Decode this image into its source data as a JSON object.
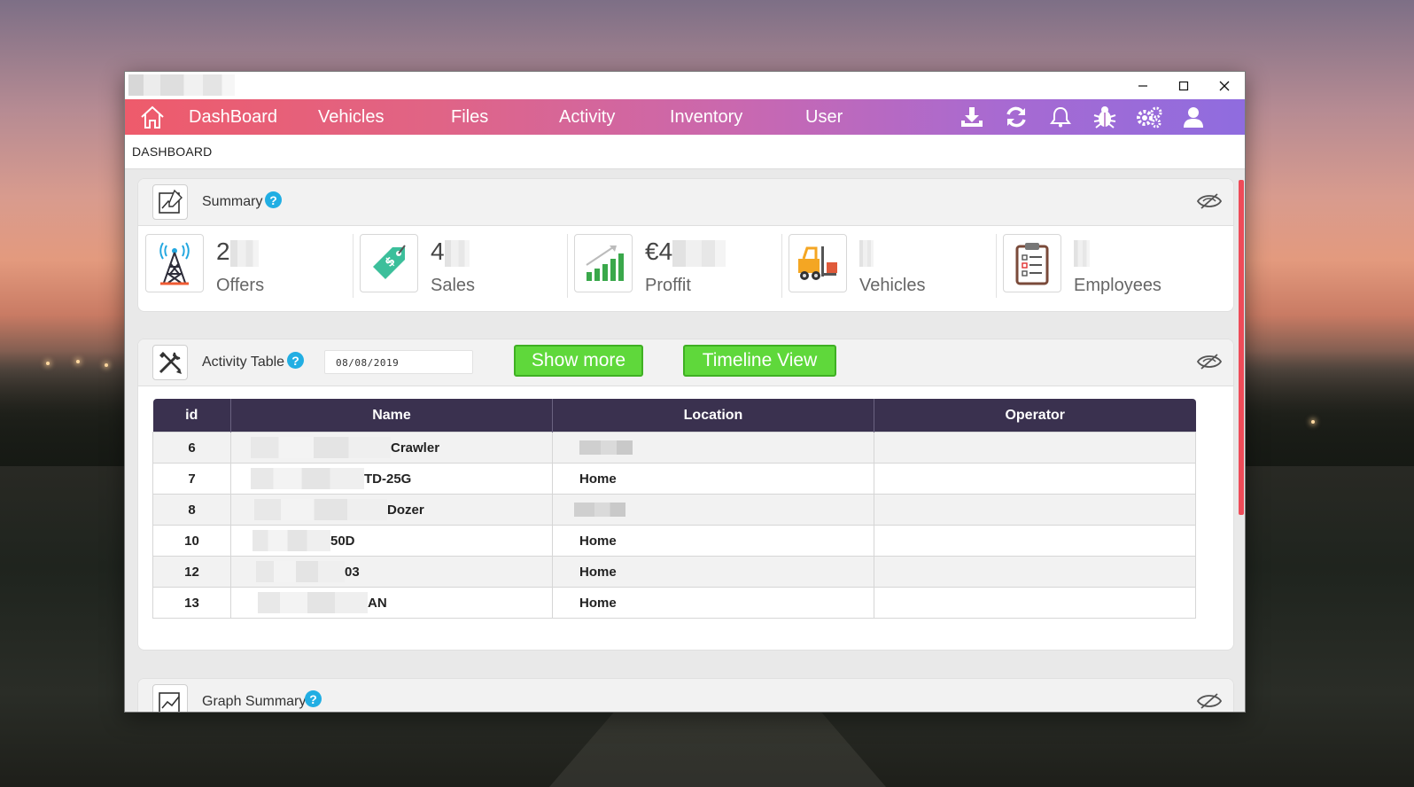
{
  "nav": {
    "items": [
      "DashBoard",
      "Vehicles",
      "Files",
      "Activity",
      "Inventory",
      "User"
    ],
    "icons": [
      "home-icon",
      "download-icon",
      "refresh-icon",
      "bell-icon",
      "bug-icon",
      "settings-icon",
      "user-icon"
    ]
  },
  "window": {
    "controls": {
      "minimize": "–",
      "maximize": "☐",
      "close": "✕"
    }
  },
  "breadcrumb": "DASHBOARD",
  "summary": {
    "title": "Summary",
    "help": "?",
    "stats": [
      {
        "value": "2",
        "label": "Offers",
        "icon": "radio-tower-icon"
      },
      {
        "value": "4",
        "label": "Sales",
        "icon": "price-tag-icon"
      },
      {
        "value": "€4",
        "label": "Proffit",
        "icon": "growth-chart-icon"
      },
      {
        "value": "",
        "label": "Vehicles",
        "icon": "forklift-icon"
      },
      {
        "value": "",
        "label": "Employees",
        "icon": "clipboard-icon"
      }
    ]
  },
  "activity": {
    "title": "Activity Table",
    "help": "?",
    "date_value": "08/08/2019",
    "show_more": "Show more",
    "timeline_view": "Timeline View",
    "columns": [
      "id",
      "Name",
      "Location",
      "Operator"
    ],
    "rows": [
      {
        "id": "6",
        "name": "Crawler",
        "location": "",
        "operator": ""
      },
      {
        "id": "7",
        "name": "TD-25G",
        "location": "Home",
        "operator": ""
      },
      {
        "id": "8",
        "name": "Dozer",
        "location": "",
        "operator": ""
      },
      {
        "id": "10",
        "name": "50D",
        "location": "Home",
        "operator": ""
      },
      {
        "id": "12",
        "name": "03",
        "location": "Home",
        "operator": ""
      },
      {
        "id": "13",
        "name": "AN",
        "location": "Home",
        "operator": ""
      }
    ]
  },
  "graph_summary": {
    "title": "Graph Summary",
    "help": "?"
  },
  "colors": {
    "nav_gradient_start": "#ee5b6b",
    "nav_gradient_end": "#8f6cdf",
    "table_header": "#3a314f",
    "button_green": "#5fd83b",
    "help_blue": "#21aee3",
    "scrollbar": "#ee4b58"
  }
}
